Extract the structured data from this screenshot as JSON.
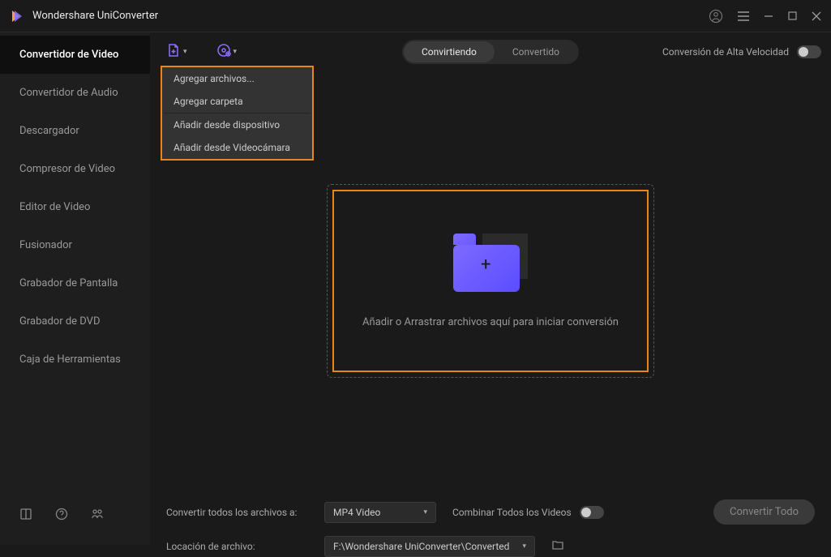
{
  "app": {
    "title": "Wondershare UniConverter"
  },
  "sidebar": {
    "items": [
      {
        "label": "Convertidor de Video"
      },
      {
        "label": "Convertidor de Audio"
      },
      {
        "label": "Descargador"
      },
      {
        "label": "Compresor de Video"
      },
      {
        "label": "Editor de Video"
      },
      {
        "label": "Fusionador"
      },
      {
        "label": "Grabador de Pantalla"
      },
      {
        "label": "Grabador de DVD"
      },
      {
        "label": "Caja de Herramientas"
      }
    ]
  },
  "toolbar": {
    "tabs": {
      "converting": "Convirtiendo",
      "converted": "Convertido"
    },
    "speed_label": "Conversión de Alta Velocidad",
    "dropdown": {
      "add_files": "Agregar archivos...",
      "add_folder": "Agregar carpeta",
      "from_device": "Añadir desde dispositivo",
      "from_camcorder": "Añadir desde Videocámara"
    }
  },
  "main": {
    "drop_text": "Añadir o Arrastrar archivos aquí para iniciar conversión"
  },
  "footer": {
    "convert_all_label": "Convertir todos los archivos a:",
    "format_selected": "MP4 Video",
    "combine_label": "Combinar Todos los Videos",
    "location_label": "Locación de archivo:",
    "location_value": "F:\\Wondershare UniConverter\\Converted",
    "convert_btn": "Convertir Todo"
  }
}
